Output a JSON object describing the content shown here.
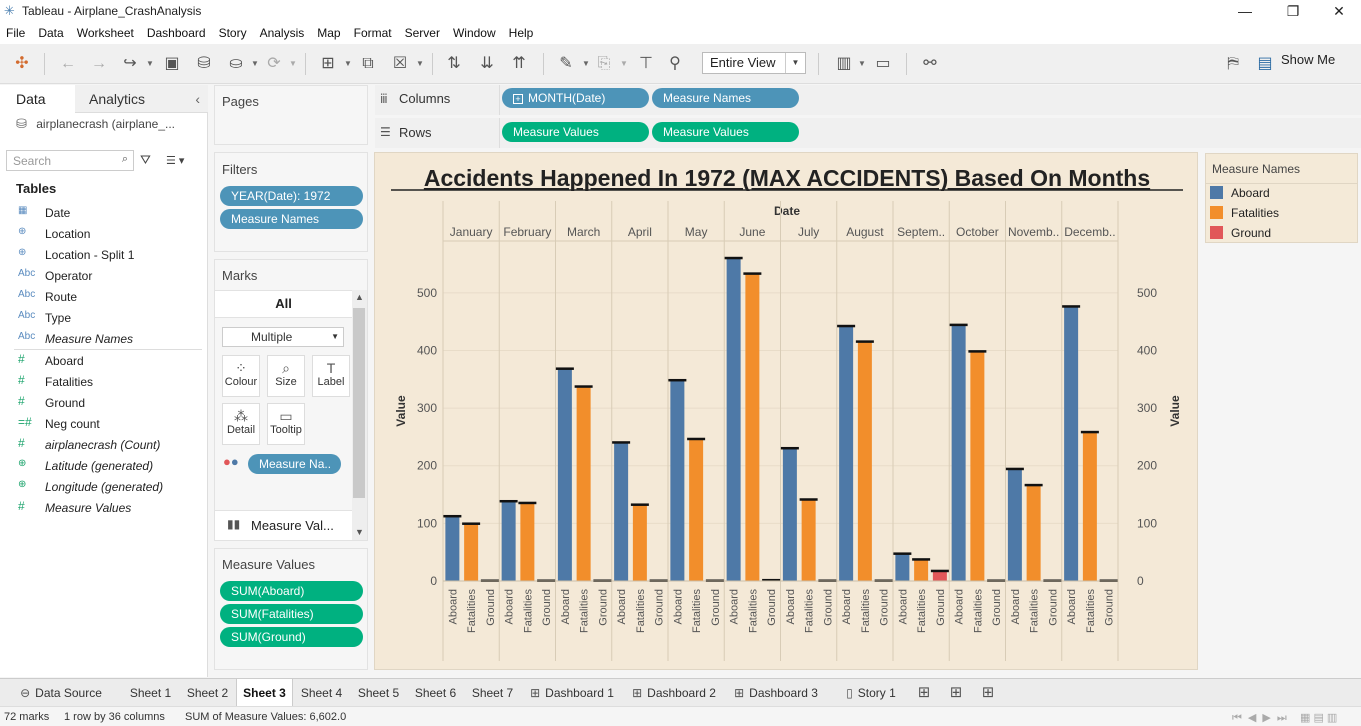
{
  "window": {
    "title": "Tableau - Airplane_CrashAnalysis"
  },
  "menu": [
    "File",
    "Data",
    "Worksheet",
    "Dashboard",
    "Story",
    "Analysis",
    "Map",
    "Format",
    "Server",
    "Window",
    "Help"
  ],
  "toolbar": {
    "view_select": "Entire View",
    "show_me": "Show Me"
  },
  "left_pane": {
    "tab_data": "Data",
    "tab_analytics": "Analytics",
    "datasource": "airplanecrash (airplane_...",
    "search_placeholder": "Search",
    "tables_heading": "Tables",
    "fields": [
      {
        "icon": "date-icon",
        "glyph": "▦",
        "label": "Date",
        "italic": false,
        "measure": false
      },
      {
        "icon": "geo-icon",
        "glyph": "⊕",
        "label": "Location",
        "italic": false,
        "measure": false
      },
      {
        "icon": "geo-split-icon",
        "glyph": "⊕",
        "label": "Location - Split 1",
        "italic": false,
        "measure": false
      },
      {
        "icon": "string-icon",
        "glyph": "Abc",
        "label": "Operator",
        "italic": false,
        "measure": false
      },
      {
        "icon": "string-icon",
        "glyph": "Abc",
        "label": "Route",
        "italic": false,
        "measure": false
      },
      {
        "icon": "string-icon",
        "glyph": "Abc",
        "label": "Type",
        "italic": false,
        "measure": false
      },
      {
        "icon": "string-icon",
        "glyph": "Abc",
        "label": "Measure Names",
        "italic": true,
        "measure": false
      },
      {
        "icon": "number-icon",
        "glyph": "#",
        "label": "Aboard",
        "italic": false,
        "measure": true
      },
      {
        "icon": "number-icon",
        "glyph": "#",
        "label": "Fatalities",
        "italic": false,
        "measure": true
      },
      {
        "icon": "number-icon",
        "glyph": "#",
        "label": "Ground",
        "italic": false,
        "measure": true
      },
      {
        "icon": "calc-number-icon",
        "glyph": "=#",
        "label": "Neg count",
        "italic": false,
        "measure": true
      },
      {
        "icon": "number-icon",
        "glyph": "#",
        "label": "airplanecrash (Count)",
        "italic": true,
        "measure": true
      },
      {
        "icon": "geo-icon",
        "glyph": "⊕",
        "label": "Latitude (generated)",
        "italic": true,
        "measure": true
      },
      {
        "icon": "geo-icon",
        "glyph": "⊕",
        "label": "Longitude (generated)",
        "italic": true,
        "measure": true
      },
      {
        "icon": "number-icon",
        "glyph": "#",
        "label": "Measure Values",
        "italic": true,
        "measure": true
      }
    ]
  },
  "cards": {
    "pages_title": "Pages",
    "filters_title": "Filters",
    "filters": [
      "YEAR(Date): 1972",
      "Measure Names"
    ],
    "marks_title": "Marks",
    "marks_all": "All",
    "mark_type": "Multiple",
    "mark_buttons": [
      {
        "icon": "colour-icon",
        "glyph": "⁘",
        "label": "Colour"
      },
      {
        "icon": "size-icon",
        "glyph": "⌕",
        "label": "Size"
      },
      {
        "icon": "label-icon",
        "glyph": "T",
        "label": "Label"
      },
      {
        "icon": "detail-icon",
        "glyph": "⁂",
        "label": "Detail"
      },
      {
        "icon": "tooltip-icon",
        "glyph": "▭",
        "label": "Tooltip"
      }
    ],
    "marks_color_pill": "Measure Na..",
    "marks_bottom": "Measure Val...",
    "measure_values_title": "Measure Values",
    "measure_values": [
      "SUM(Aboard)",
      "SUM(Fatalities)",
      "SUM(Ground)"
    ]
  },
  "shelves": {
    "columns_label": "Columns",
    "columns": [
      "MONTH(Date)",
      "Measure Names"
    ],
    "rows_label": "Rows",
    "rows": [
      "Measure Values",
      "Measure Values"
    ]
  },
  "legend": {
    "title": "Measure Names",
    "items": [
      {
        "label": "Aboard",
        "color": "#4e79a7"
      },
      {
        "label": "Fatalities",
        "color": "#f28e2b"
      },
      {
        "label": "Ground",
        "color": "#e15759"
      }
    ]
  },
  "chart_data": {
    "type": "bar",
    "title": "Accidents Happened In 1972 (MAX ACCIDENTS) Based On Months",
    "xlabel": "Date",
    "ylabel": "Value",
    "ylim": [
      0,
      590
    ],
    "yticks": [
      0,
      100,
      200,
      300,
      400,
      500
    ],
    "categories": [
      "January",
      "February",
      "March",
      "April",
      "May",
      "June",
      "July",
      "August",
      "Septem..",
      "October",
      "Novemb..",
      "Decemb.."
    ],
    "sub_categories": [
      "Aboard",
      "Fatalities",
      "Ground"
    ],
    "series": [
      {
        "name": "Aboard",
        "color": "#4e79a7",
        "values": [
          112,
          138,
          368,
          240,
          348,
          560,
          230,
          442,
          47,
          444,
          194,
          476
        ]
      },
      {
        "name": "Fatalities",
        "color": "#f28e2b",
        "values": [
          99,
          135,
          337,
          132,
          246,
          533,
          141,
          415,
          37,
          398,
          166,
          258
        ]
      },
      {
        "name": "Ground",
        "color": "#e15759",
        "values": [
          0,
          0,
          0,
          0,
          0,
          1,
          0,
          0,
          17,
          0,
          0,
          0
        ]
      }
    ],
    "grid": true,
    "legend": "right"
  },
  "sheet_tabs": [
    {
      "label": "Data Source",
      "icon": "datasource-icon",
      "glyph": "⊖"
    },
    {
      "label": "Sheet 1",
      "icon": "",
      "glyph": ""
    },
    {
      "label": "Sheet 2",
      "icon": "",
      "glyph": ""
    },
    {
      "label": "Sheet 3",
      "icon": "",
      "glyph": "",
      "active": true
    },
    {
      "label": "Sheet 4",
      "icon": "",
      "glyph": ""
    },
    {
      "label": "Sheet 5",
      "icon": "",
      "glyph": ""
    },
    {
      "label": "Sheet 6",
      "icon": "",
      "glyph": ""
    },
    {
      "label": "Sheet 7",
      "icon": "",
      "glyph": ""
    },
    {
      "label": "Dashboard 1",
      "icon": "dashboard-icon",
      "glyph": "⊞"
    },
    {
      "label": "Dashboard 2",
      "icon": "dashboard-icon",
      "glyph": "⊞"
    },
    {
      "label": "Dashboard 3",
      "icon": "dashboard-icon",
      "glyph": "⊞"
    },
    {
      "label": "Story 1",
      "icon": "story-icon",
      "glyph": "▯"
    }
  ],
  "status": {
    "marks": "72 marks",
    "rows_cols": "1 row by 36 columns",
    "sum": "SUM of Measure Values: 6,602.0"
  }
}
